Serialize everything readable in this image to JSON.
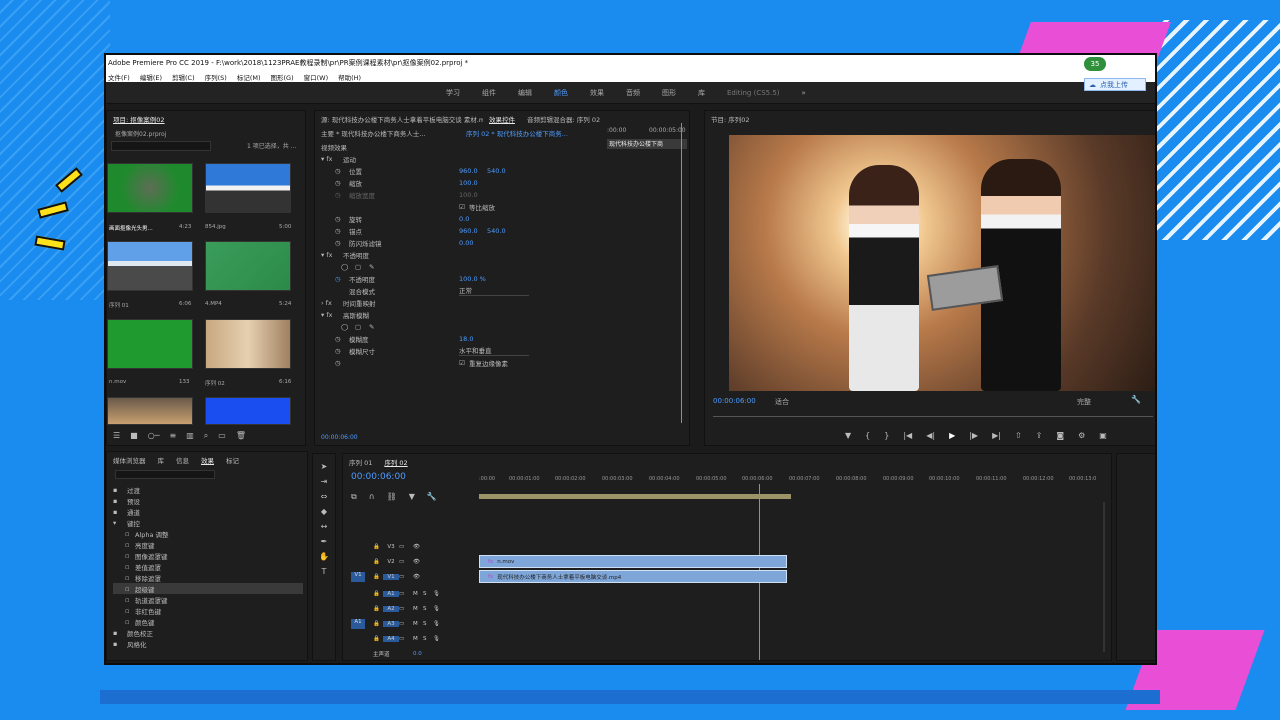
{
  "window_title": "Adobe Premiere Pro CC 2019 - F:\\work\\2018\\1123PRAE教程录制\\pr\\PR案例课程素材\\pr\\抠像案例02.prproj *",
  "menu": [
    "文件(F)",
    "编辑(E)",
    "剪辑(C)",
    "序列(S)",
    "标记(M)",
    "图形(G)",
    "窗口(W)",
    "帮助(H)"
  ],
  "workspaces": [
    "学习",
    "组件",
    "编辑",
    "颜色",
    "效果",
    "音频",
    "图形",
    "库",
    "Editing (CS5.5)"
  ],
  "active_workspace": "颜色",
  "badge_count": "35",
  "badge_button": "点我上传",
  "project": {
    "tab": "项目: 抠像案例02",
    "file": "抠像案例02.prproj",
    "selection": "1 项已选择，共 ...",
    "items": [
      {
        "label": "画面抠像光头男...",
        "dur": "4:23"
      },
      {
        "label": "854.jpg",
        "dur": "5:00"
      },
      {
        "label": "序列 01",
        "dur": "6:06"
      },
      {
        "label": "4.MP4",
        "dur": "5:24"
      },
      {
        "label": "n.mov",
        "dur": "133"
      },
      {
        "label": "序列 02",
        "dur": "6:16"
      }
    ]
  },
  "effect_controls": {
    "tabs": [
      "源: 现代科技办公楼下商务人士拿着平板电脑交谈 素材.mp4",
      "效果控件",
      "音频剪辑混合器: 序列 02"
    ],
    "master": "主要 * 现代科技办公楼下商务人士...",
    "sequence": "序列 02 * 现代科技办公楼下商务...",
    "video_effects": "视频效果",
    "clip_label": "现代科技办公楼下商",
    "time_start": ":00:00",
    "time_end": "00:00:05:00",
    "rows": [
      {
        "name": "运动",
        "v1": "",
        "v2": ""
      },
      {
        "name": "位置",
        "v1": "960.0",
        "v2": "540.0"
      },
      {
        "name": "缩放",
        "v1": "100.0",
        "v2": ""
      },
      {
        "name": "缩放宽度",
        "v1": "100.0",
        "v2": ""
      },
      {
        "name": "等比缩放",
        "v1": "",
        "v2": ""
      },
      {
        "name": "旋转",
        "v1": "0.0",
        "v2": ""
      },
      {
        "name": "锚点",
        "v1": "960.0",
        "v2": "540.0"
      },
      {
        "name": "防闪烁滤镜",
        "v1": "0.00",
        "v2": ""
      },
      {
        "name": "不透明度",
        "v1": "",
        "v2": ""
      },
      {
        "name": "不透明度",
        "v1": "100.0 %",
        "v2": ""
      },
      {
        "name": "混合模式",
        "v1": "正常",
        "v2": ""
      },
      {
        "name": "时间重映射",
        "v1": "",
        "v2": ""
      },
      {
        "name": "高斯模糊",
        "v1": "",
        "v2": ""
      },
      {
        "name": "模糊度",
        "v1": "18.0",
        "v2": ""
      },
      {
        "name": "模糊尺寸",
        "v1": "水平和垂直",
        "v2": ""
      },
      {
        "name": "重复边缘像素",
        "v1": "",
        "v2": ""
      }
    ],
    "timecode": "00:00:06:00"
  },
  "program": {
    "tab": "节目: 序列02",
    "timecode": "00:00:06:00",
    "fit": "适合",
    "quality": "完整"
  },
  "effects": {
    "tabs": [
      "媒体浏览器",
      "库",
      "信息",
      "效果",
      "标记"
    ],
    "items": [
      "过渡",
      "预设",
      "通道",
      "键控",
      "Alpha 调整",
      "亮度键",
      "图像遮罩键",
      "差值遮罩",
      "移除遮罩",
      "超级键",
      "轨道遮罩键",
      "非红色键",
      "颜色键",
      "颜色校正",
      "风格化"
    ]
  },
  "timeline": {
    "tabs": [
      "序列 01",
      "序列 02"
    ],
    "timecode": "00:00:06:00",
    "ruler": [
      ":00:00",
      "00:00:01:00",
      "00:00:02:00",
      "00:00:03:00",
      "00:00:04:00",
      "00:00:05:00",
      "00:00:06:00",
      "00:00:07:00",
      "00:00:08:00",
      "00:00:09:00",
      "00:00:10:00",
      "00:00:11:00",
      "00:00:12:00",
      "00:00:13:0"
    ],
    "tracks": [
      "V3",
      "V2",
      "V1",
      "A1",
      "A2",
      "A3",
      "A4"
    ],
    "master": "主声道",
    "master_val": "0.0",
    "clip_top": "n.mov",
    "clip_main": "现代科技办公楼下商务人士拿着平板电脑交谈.mp4"
  },
  "colors": {
    "accent": "#4d9cff",
    "bg": "#1a8cf0",
    "pink": "#e94fd6"
  }
}
